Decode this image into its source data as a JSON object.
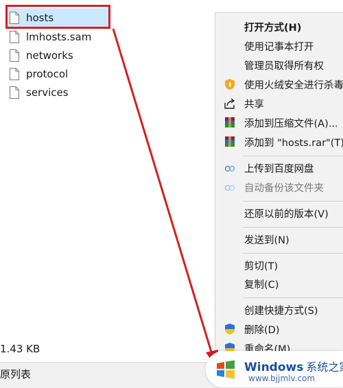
{
  "files": [
    {
      "name": "hosts",
      "selected": true
    },
    {
      "name": "lmhosts.sam",
      "selected": false
    },
    {
      "name": "networks",
      "selected": false
    },
    {
      "name": "protocol",
      "selected": false
    },
    {
      "name": "services",
      "selected": false
    }
  ],
  "status": {
    "size": "1.43 KB",
    "bottom_label": "原列表"
  },
  "context_menu": {
    "items": [
      {
        "label": "打开方式(H)",
        "icon": "none",
        "bold": true
      },
      {
        "label": "使用记事本打开",
        "icon": "none"
      },
      {
        "label": "管理员取得所有权",
        "icon": "none"
      },
      {
        "label": "使用火绒安全进行杀毒",
        "icon": "huorong-shield-icon"
      },
      {
        "label": "共享",
        "icon": "share-icon"
      },
      {
        "label": "添加到压缩文件(A)...",
        "icon": "winrar-icon"
      },
      {
        "label": "添加到 \"hosts.rar\"(T)",
        "icon": "winrar-icon"
      },
      {
        "label": "上传到百度网盘",
        "icon": "baidu-netdisk-icon"
      },
      {
        "label": "自动备份该文件夹",
        "icon": "baidu-netdisk-icon",
        "dim": true
      },
      {
        "label": "还原以前的版本(V)",
        "icon": "none"
      },
      {
        "label": "发送到(N)",
        "icon": "none"
      },
      {
        "label": "剪切(T)",
        "icon": "none"
      },
      {
        "label": "复制(C)",
        "icon": "none"
      },
      {
        "label": "创建快捷方式(S)",
        "icon": "none"
      },
      {
        "label": "删除(D)",
        "icon": "uac-shield-icon"
      },
      {
        "label": "重命名(M)",
        "icon": "uac-shield-icon"
      }
    ]
  },
  "watermark": {
    "brand": "Windows",
    "brand_cn": "系统之家",
    "url": "www.bjjmlv.com"
  },
  "colors": {
    "highlight": "#cce8ff",
    "annotation_red": "#d32020",
    "menu_bg": "#f2f2f2"
  }
}
